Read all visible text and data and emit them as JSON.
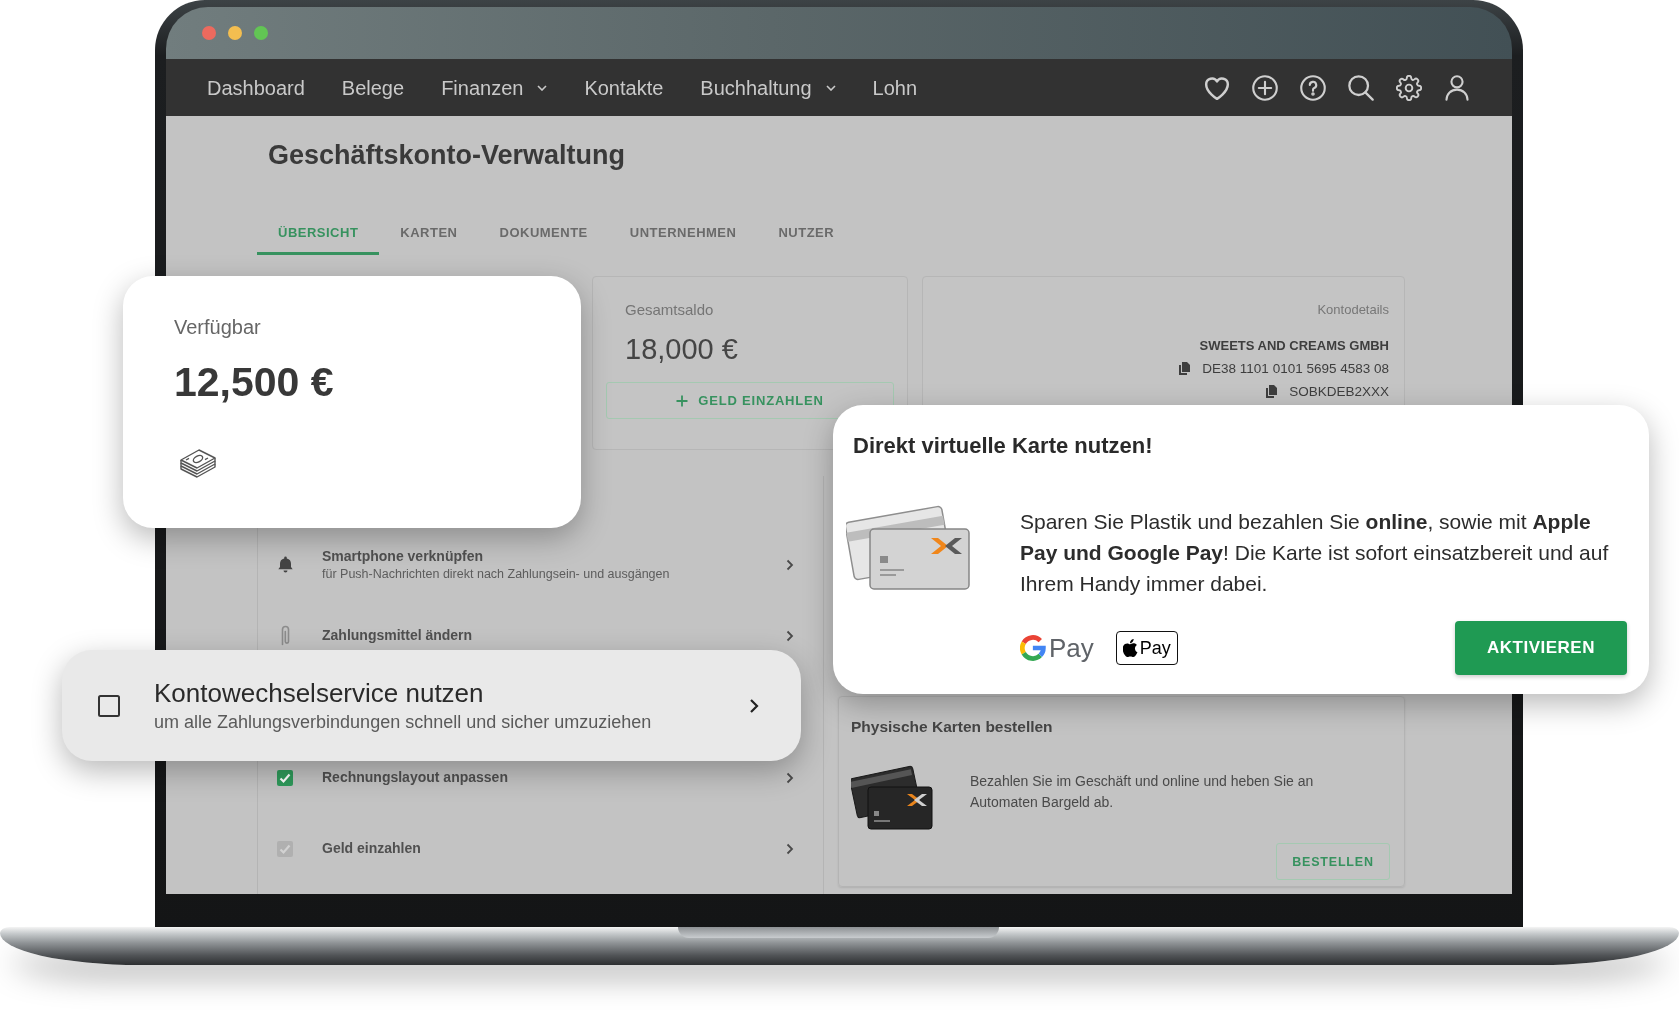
{
  "nav": {
    "items": [
      {
        "label": "Dashboard",
        "dropdown": false
      },
      {
        "label": "Belege",
        "dropdown": false
      },
      {
        "label": "Finanzen",
        "dropdown": true
      },
      {
        "label": "Kontakte",
        "dropdown": false
      },
      {
        "label": "Buchhaltung",
        "dropdown": true
      },
      {
        "label": "Lohn",
        "dropdown": false
      }
    ]
  },
  "page": {
    "title": "Geschäftskonto-Verwaltung"
  },
  "tabs": [
    {
      "label": "ÜBERSICHT",
      "selected": true
    },
    {
      "label": "KARTEN",
      "selected": false
    },
    {
      "label": "DOKUMENTE",
      "selected": false
    },
    {
      "label": "UNTERNEHMEN",
      "selected": false
    },
    {
      "label": "NUTZER",
      "selected": false
    }
  ],
  "balance": {
    "label": "Gesamtsaldo",
    "amount": "18,000 €",
    "button": "GELD EINZAHLEN"
  },
  "account_details": {
    "label": "Kontodetails",
    "holder": "SWEETS AND CREAMS GMBH",
    "iban": "DE38 1101 0101 5695 4583 08",
    "bic": "SOBKDEB2XXX"
  },
  "tasks": [
    {
      "kind": "notify",
      "title": "Smartphone verknüpfen",
      "subtitle": "für Push-Nachrichten direkt nach Zahlungsein- und ausgängen"
    },
    {
      "kind": "payment",
      "title": "Zahlungsmittel ändern"
    },
    {
      "kind": "todo",
      "title": "Rechnungslayout anpassen",
      "checked": true
    },
    {
      "kind": "todo",
      "title": "Geld einzahlen",
      "checked": false
    }
  ],
  "order_card": {
    "title": "Physische Karten bestellen",
    "text": "Bezahlen Sie im Geschäft und online und heben Sie an Automaten Bargeld ab.",
    "button": "BESTELLEN"
  },
  "available_card": {
    "label": "Verfügbar",
    "amount": "12,500 €"
  },
  "switch_card": {
    "title": "Kontowechselservice nutzen",
    "subtitle": "um alle Zahlungsverbindungen schnell und sicher umzuziehen",
    "checked": false
  },
  "virtual_card_popup": {
    "title": "Direkt virtuelle Karte nutzen!",
    "text": "Sparen Sie Plastik und bezahlen Sie **online**, sowie mit **Apple Pay und Google Pay**! Die Karte ist sofort einsatzbereit und auf Ihrem Handy immer dabei.",
    "wallets": [
      {
        "kind": "google",
        "label": "Pay"
      },
      {
        "kind": "apple",
        "label": "Pay"
      }
    ],
    "button": "AKTIVIEREN"
  }
}
